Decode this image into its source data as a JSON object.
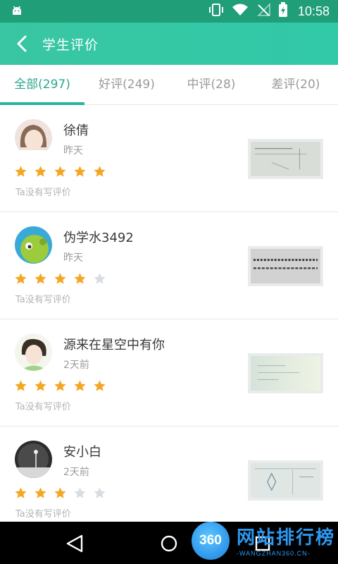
{
  "status_bar": {
    "time": "10:58",
    "icons": [
      "android-icon",
      "vibrate-icon",
      "wifi-icon",
      "no-signal-icon",
      "battery-icon"
    ]
  },
  "app_bar": {
    "title": "学生评价",
    "back_icon": "back-arrow-icon"
  },
  "tabs": [
    {
      "label": "全部(297)",
      "active": true
    },
    {
      "label": "好评(249)",
      "active": false
    },
    {
      "label": "中评(28)",
      "active": false
    },
    {
      "label": "差评(20)",
      "active": false
    }
  ],
  "reviews": [
    {
      "name": "徐倩",
      "time": "昨天",
      "rating": 5,
      "comment": "Ta没有写评价"
    },
    {
      "name": "伪学水3492",
      "time": "昨天",
      "rating": 4,
      "comment": "Ta没有写评价"
    },
    {
      "name": "源来在星空中有你",
      "time": "2天前",
      "rating": 5,
      "comment": "Ta没有写评价"
    },
    {
      "name": "安小白",
      "time": "2天前",
      "rating": 3,
      "comment": "Ta没有写评价"
    }
  ],
  "nav_bar": {
    "buttons": [
      "back-triangle-icon",
      "home-circle-icon",
      "recents-square-icon"
    ]
  },
  "watermark": {
    "logo_text": "360",
    "title": "网站排行榜",
    "subtitle": "-WANGZHAN360.CN-"
  },
  "colors": {
    "accent": "#2ab69a",
    "star_on": "#f5a623",
    "star_off": "#d8dde2"
  }
}
